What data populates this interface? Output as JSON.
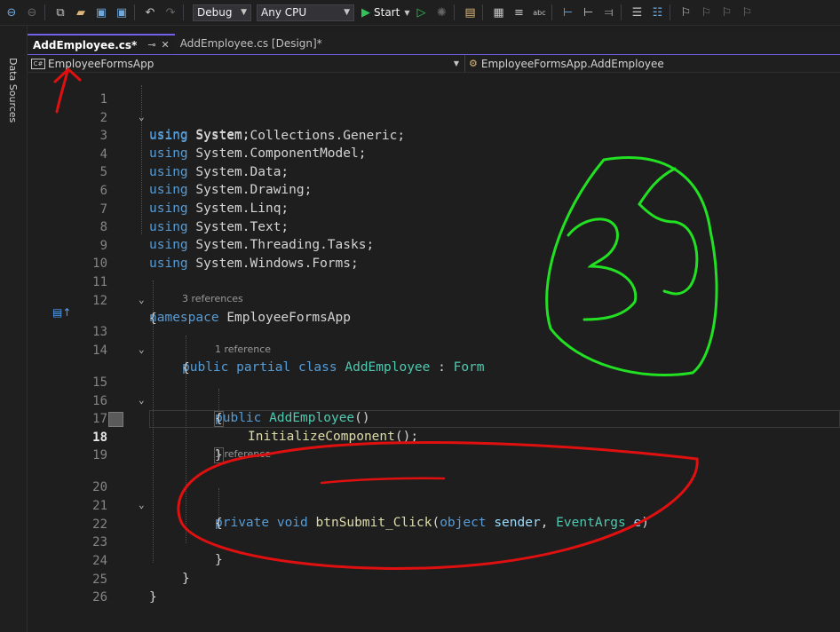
{
  "toolbar": {
    "configuration": "Debug",
    "platform": "Any CPU",
    "start_label": "Start",
    "icons": [
      "back-icon",
      "forward-icon",
      "new-item-icon",
      "open-icon",
      "save-icon",
      "save-all-icon",
      "undo-icon",
      "redo-icon",
      "start-icon",
      "start-without-debug-icon",
      "hot-reload-icon",
      "solution-explorer-icon",
      "layout-icon",
      "spell-check-icon",
      "format-icon",
      "comment-icon",
      "uncomment-icon",
      "bookmark-icon",
      "bookmark-next-icon"
    ]
  },
  "left_strip": {
    "label": "Data Sources"
  },
  "tabs": [
    {
      "label": "AddEmployee.cs*",
      "active": true
    },
    {
      "label": "AddEmployee.cs [Design]*",
      "active": false
    }
  ],
  "nav": {
    "project": "EmployeeFormsApp",
    "class": "EmployeeFormsApp.AddEmployee"
  },
  "code": {
    "line_numbers": [
      "1",
      "2",
      "3",
      "4",
      "5",
      "6",
      "7",
      "8",
      "9",
      "10",
      "11",
      "12",
      "13",
      "14",
      "15",
      "16",
      "17",
      "18",
      "19",
      "20",
      "21",
      "22",
      "23",
      "24",
      "25",
      "26"
    ],
    "usings": [
      "System",
      "System.Collections.Generic",
      "System.ComponentModel",
      "System.Data",
      "System.Drawing",
      "System.Linq",
      "System.Text",
      "System.Threading.Tasks",
      "System.Windows.Forms"
    ],
    "kw_using": "using",
    "kw_namespace": "namespace",
    "namespace_name": "EmployeeFormsApp",
    "lens_class": "3 references",
    "lens_ctor": "1 reference",
    "lens_method": "1 reference",
    "kw_public": "public",
    "kw_partial": "partial",
    "kw_class": "class",
    "class_name": "AddEmployee",
    "base_class": "Form",
    "ctor_name": "AddEmployee",
    "init_call": "InitializeComponent",
    "kw_private": "private",
    "kw_void": "void",
    "method_name": "btnSubmit_Click",
    "kw_object": "object",
    "param_sender": "sender",
    "type_eventargs": "EventArgs",
    "param_e": "e"
  },
  "annotation_colors": {
    "red": "#e01010",
    "green": "#22e022"
  }
}
